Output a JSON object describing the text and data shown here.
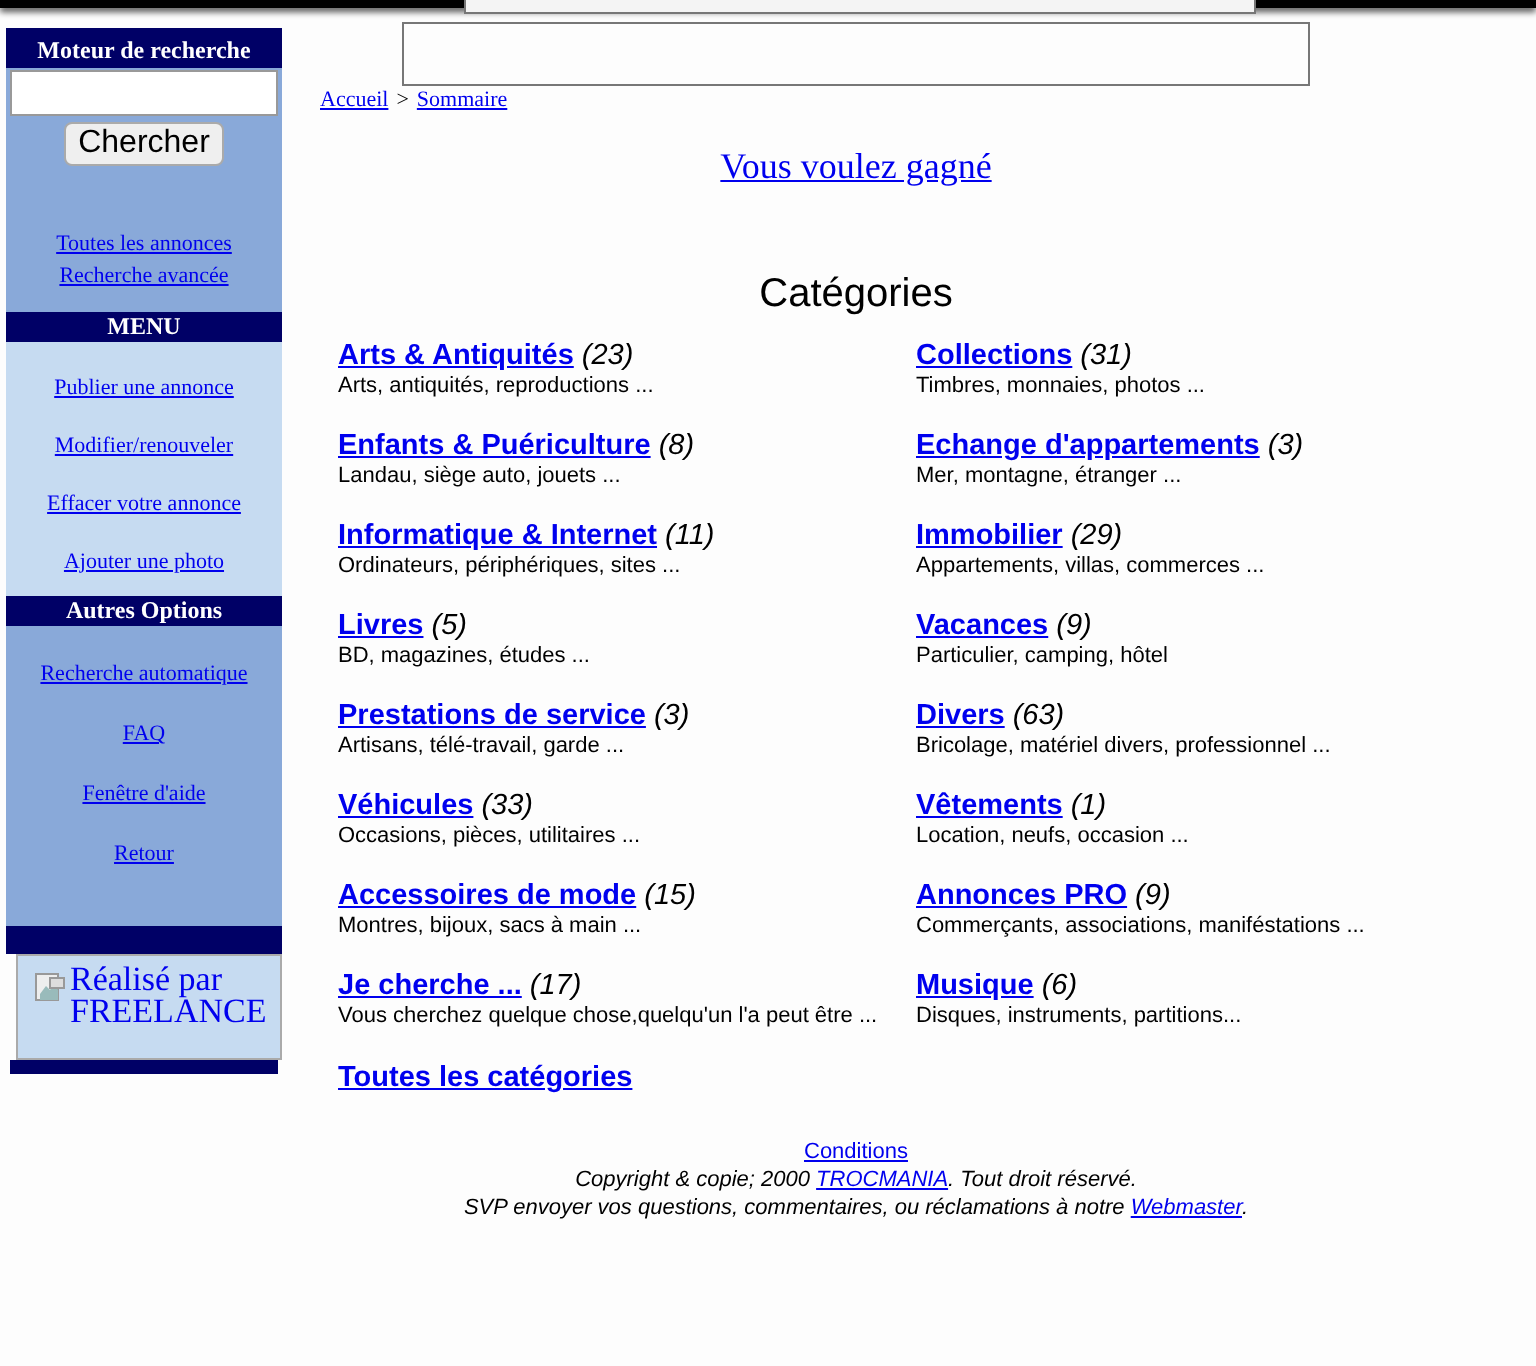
{
  "sidebar": {
    "search": {
      "title": "Moteur de recherche",
      "button": "Chercher",
      "links": [
        "Toutes les annonces",
        "Recherche avancée"
      ]
    },
    "menu": {
      "title": "MENU",
      "links": [
        "Publier une annonce",
        "Modifier/renouveler",
        "Effacer votre annonce",
        "Ajouter une photo"
      ]
    },
    "options": {
      "title": "Autres Options",
      "links": [
        "Recherche automatique",
        "FAQ",
        "Fenêtre d'aide",
        "Retour"
      ]
    },
    "credit": "Réalisé par FREELANCE"
  },
  "breadcrumb": {
    "items": [
      "Accueil",
      "Sommaire"
    ],
    "separator": ">"
  },
  "promo_link": "Vous voulez gagné",
  "categories": {
    "title": "Catégories",
    "items": [
      {
        "name": "Arts & Antiquités",
        "count": "(23)",
        "description": "Arts, antiquités, reproductions ..."
      },
      {
        "name": "Collections",
        "count": "(31)",
        "description": "Timbres, monnaies, photos ..."
      },
      {
        "name": "Enfants & Puériculture",
        "count": "(8)",
        "description": "Landau, siège auto, jouets ..."
      },
      {
        "name": "Echange d'appartements",
        "count": "(3)",
        "description": "Mer, montagne, étranger ..."
      },
      {
        "name": "Informatique & Internet",
        "count": "(11)",
        "description": "Ordinateurs, périphériques, sites ..."
      },
      {
        "name": "Immobilier",
        "count": "(29)",
        "description": "Appartements, villas, commerces ..."
      },
      {
        "name": "Livres",
        "count": "(5)",
        "description": "BD, magazines, études ..."
      },
      {
        "name": "Vacances",
        "count": "(9)",
        "description": "Particulier, camping, hôtel"
      },
      {
        "name": "Prestations de service",
        "count": "(3)",
        "description": "Artisans, télé-travail, garde ..."
      },
      {
        "name": "Divers",
        "count": "(63)",
        "description": "Bricolage, matériel divers, professionnel ..."
      },
      {
        "name": "Véhicules",
        "count": "(33)",
        "description": "Occasions, pièces, utilitaires ..."
      },
      {
        "name": "Vêtements",
        "count": "(1)",
        "description": "Location, neufs, occasion ..."
      },
      {
        "name": "Accessoires de mode",
        "count": "(15)",
        "description": "Montres, bijoux, sacs à main ..."
      },
      {
        "name": "Annonces PRO",
        "count": "(9)",
        "description": "Commerçants, associations, maniféstations ..."
      },
      {
        "name": "Je cherche ...",
        "count": "(17)",
        "description": "Vous cherchez quelque chose,quelqu'un l'a peut être ..."
      },
      {
        "name": "Musique",
        "count": "(6)",
        "description": "Disques, instruments, partitions..."
      }
    ],
    "all_link": "Toutes les catégories"
  },
  "footer": {
    "conditions": "Conditions",
    "copyright": {
      "before": "Copyright & copie; 2000 ",
      "link": "TROCMANIA",
      "after": ". Tout droit réservé."
    },
    "contact": {
      "before": "SVP envoyer vos questions, commentaires, ou réclamations à notre ",
      "link": "Webmaster",
      "after": "."
    }
  }
}
